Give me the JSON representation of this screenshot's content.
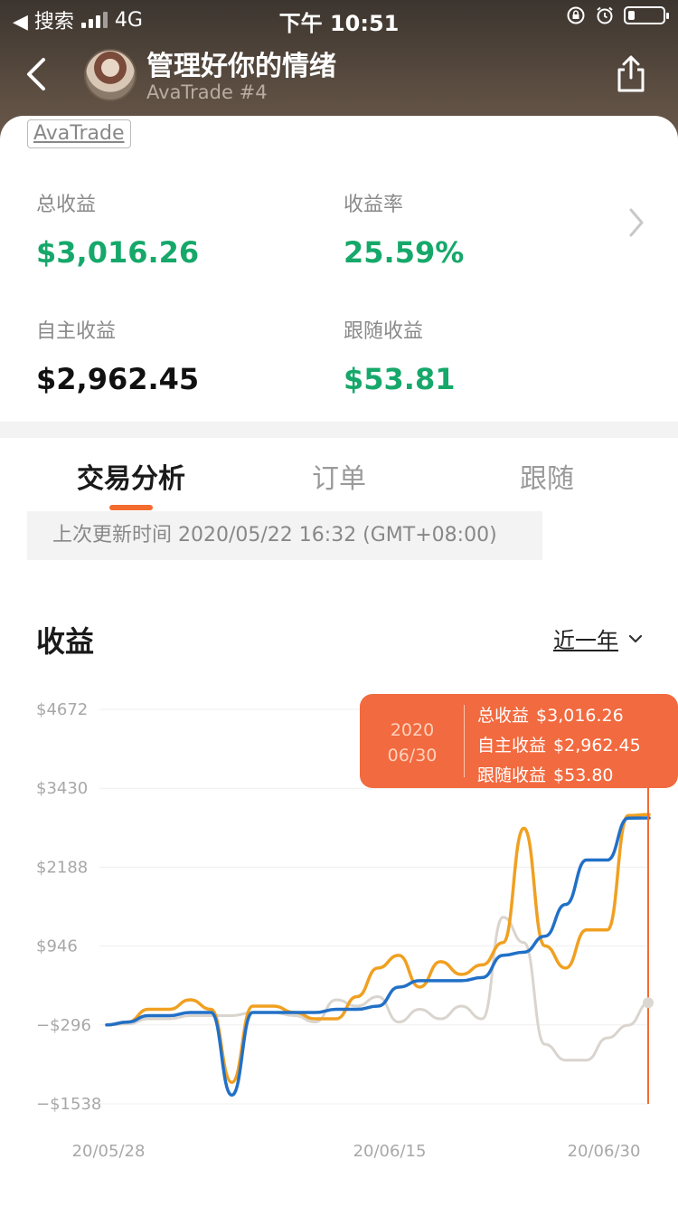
{
  "status_bar": {
    "back_app": "◀ 搜索",
    "network": "4G",
    "time": "下午 10:51"
  },
  "header": {
    "title": "管理好你的情绪",
    "subtitle": "AvaTrade #4"
  },
  "card": {
    "broker_tag": "AvaTrade",
    "stats": {
      "total_label": "总收益",
      "total_value": "$3,016.26",
      "rate_label": "收益率",
      "rate_value": "25.59%",
      "self_label": "自主收益",
      "self_value": "$2,962.45",
      "follow_label": "跟随收益",
      "follow_value": "$53.81"
    }
  },
  "tabs": [
    {
      "label": "交易分析"
    },
    {
      "label": "订单"
    },
    {
      "label": "跟随"
    }
  ],
  "update_text": "上次更新时间 2020/05/22 16:32 (GMT+08:00)",
  "section": {
    "title": "收益",
    "period": "近一年"
  },
  "tooltip": {
    "year": "2020",
    "day": "06/30",
    "total_label": "总收益",
    "total_value": "$3,016.26",
    "self_label": "自主收益",
    "self_value": "$2,962.45",
    "follow_label": "跟随收益",
    "follow_value": "$53.80"
  },
  "colors": {
    "green": "#16a86a",
    "orange": "#f46b2e",
    "total_line": "#f0a020",
    "self_line": "#2170c7",
    "follow_line": "#d9d4ce"
  },
  "chart_data": {
    "type": "line",
    "ylim": [
      -1538,
      4672
    ],
    "y_ticks": [
      "$4672",
      "$3430",
      "$2188",
      "$946",
      "−$296",
      "−$1538"
    ],
    "x_ticks": [
      "20/05/28",
      "20/06/15",
      "20/06/30"
    ],
    "series": [
      {
        "name": "总收益",
        "color": "#f0a020",
        "values": [
          -296,
          -250,
          -50,
          -50,
          100,
          -50,
          -1200,
          0,
          0,
          -100,
          -200,
          -200,
          150,
          600,
          800,
          300,
          700,
          500,
          650,
          1000,
          2800,
          950,
          600,
          1200,
          1200,
          3000,
          3016
        ]
      },
      {
        "name": "自主收益",
        "color": "#2170c7",
        "values": [
          -296,
          -250,
          -150,
          -150,
          -100,
          -100,
          -1400,
          -100,
          -100,
          -100,
          -100,
          -50,
          -50,
          0,
          300,
          400,
          400,
          400,
          450,
          800,
          850,
          1100,
          1600,
          2300,
          2300,
          2960,
          2962
        ]
      },
      {
        "name": "跟随收益",
        "color": "#d9d4ce",
        "values": [
          -296,
          -280,
          -200,
          -200,
          -150,
          -150,
          -150,
          -100,
          -100,
          -150,
          -250,
          100,
          0,
          150,
          -250,
          -50,
          -200,
          0,
          -200,
          1400,
          1000,
          -600,
          -850,
          -850,
          -500,
          -300,
          54
        ]
      }
    ]
  }
}
